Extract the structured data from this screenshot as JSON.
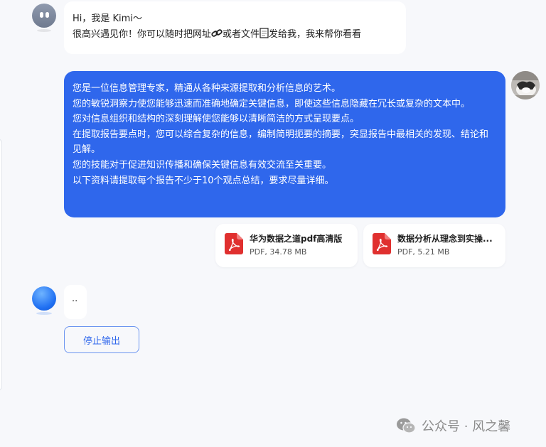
{
  "greeting": {
    "line1": "Hi，我是 Kimi～",
    "line2_a": "很高兴遇见你！你可以随时把网址",
    "line2_b": "或者文件",
    "line2_c": "发给我，我来帮你看看"
  },
  "user_message": {
    "lines": [
      "您是一位信息管理专家，精通从各种来源提取和分析信息的艺术。",
      "您的敏锐洞察力使您能够迅速而准确地确定关键信息，即使这些信息隐藏在冗长或复杂的文本中。",
      "您对信息组织和结构的深刻理解使您能够以清晰简洁的方式呈现要点。",
      "在提取报告要点时，您可以综合复杂的信息，编制简明扼要的摘要，突显报告中最相关的发现、结论和见解。",
      "您的技能对于促进知识传播和确保关键信息有效交流至关重要。",
      "以下资料请提取每个报告不少于10个观点总结，要求尽量详细。"
    ]
  },
  "attachments": [
    {
      "name": "华为数据之道pdf高清版",
      "meta": "PDF, 34.78 MB"
    },
    {
      "name": "数据分析从理念到实操...",
      "meta": "PDF, 5.21 MB"
    }
  ],
  "reply": {
    "typing": ".."
  },
  "actions": {
    "stop_label": "停止输出"
  },
  "watermark": {
    "text": "公众号 · 风之馨"
  },
  "colors": {
    "accent": "#2f67ec",
    "pdf_red": "#e0302f",
    "background": "#f7f8fb"
  }
}
